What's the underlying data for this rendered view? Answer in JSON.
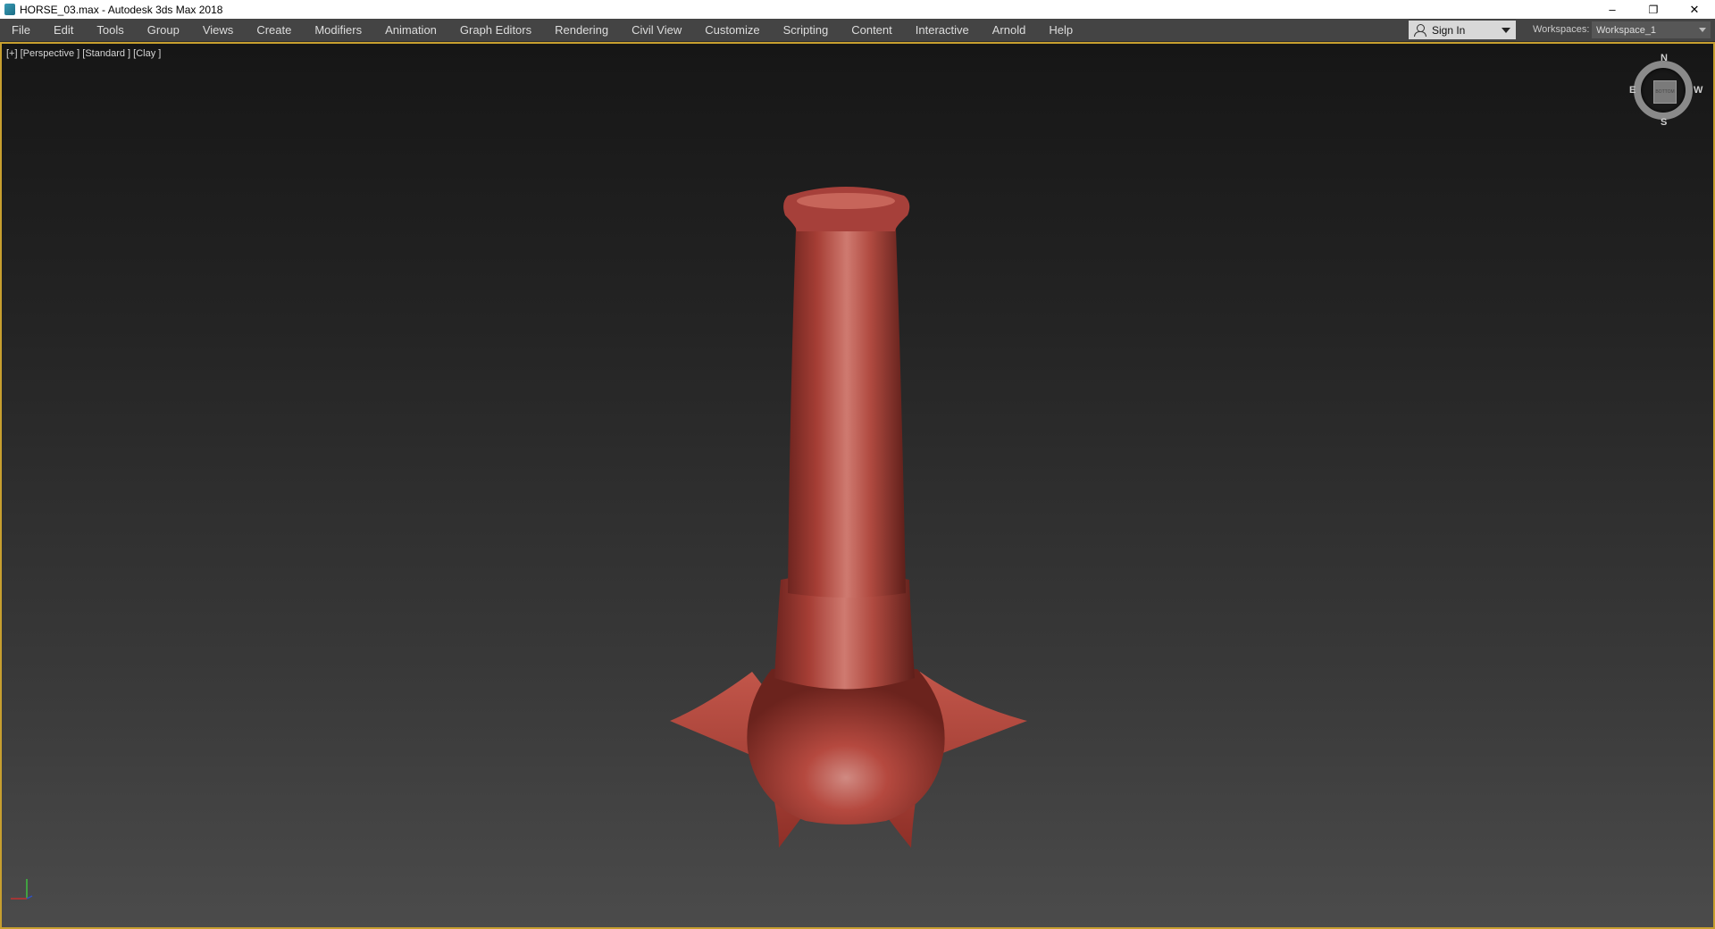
{
  "window": {
    "title": "HORSE_03.max - Autodesk 3ds Max 2018",
    "minimize_glyph": "–",
    "restore_glyph": "❐",
    "close_glyph": "✕"
  },
  "menu": {
    "items": [
      {
        "label": "File",
        "name": "menu-file"
      },
      {
        "label": "Edit",
        "name": "menu-edit"
      },
      {
        "label": "Tools",
        "name": "menu-tools"
      },
      {
        "label": "Group",
        "name": "menu-group"
      },
      {
        "label": "Views",
        "name": "menu-views"
      },
      {
        "label": "Create",
        "name": "menu-create"
      },
      {
        "label": "Modifiers",
        "name": "menu-modifiers"
      },
      {
        "label": "Animation",
        "name": "menu-animation"
      },
      {
        "label": "Graph Editors",
        "name": "menu-graph-editors"
      },
      {
        "label": "Rendering",
        "name": "menu-rendering"
      },
      {
        "label": "Civil View",
        "name": "menu-civil-view"
      },
      {
        "label": "Customize",
        "name": "menu-customize"
      },
      {
        "label": "Scripting",
        "name": "menu-scripting"
      },
      {
        "label": "Content",
        "name": "menu-content"
      },
      {
        "label": "Interactive",
        "name": "menu-interactive"
      },
      {
        "label": "Arnold",
        "name": "menu-arnold"
      },
      {
        "label": "Help",
        "name": "menu-help"
      }
    ],
    "sign_in_label": "Sign In",
    "workspaces_label": "Workspaces:",
    "workspace_value": "Workspace_1"
  },
  "viewport": {
    "label": "[+] [Perspective ] [Standard ] [Clay ]",
    "border_color": "#c79f2f",
    "model_color": "#b5483e",
    "viewcube": {
      "face_label": "BOTTOM",
      "compass_n": "N",
      "compass_s": "S",
      "compass_e": "E",
      "compass_w": "W"
    }
  }
}
